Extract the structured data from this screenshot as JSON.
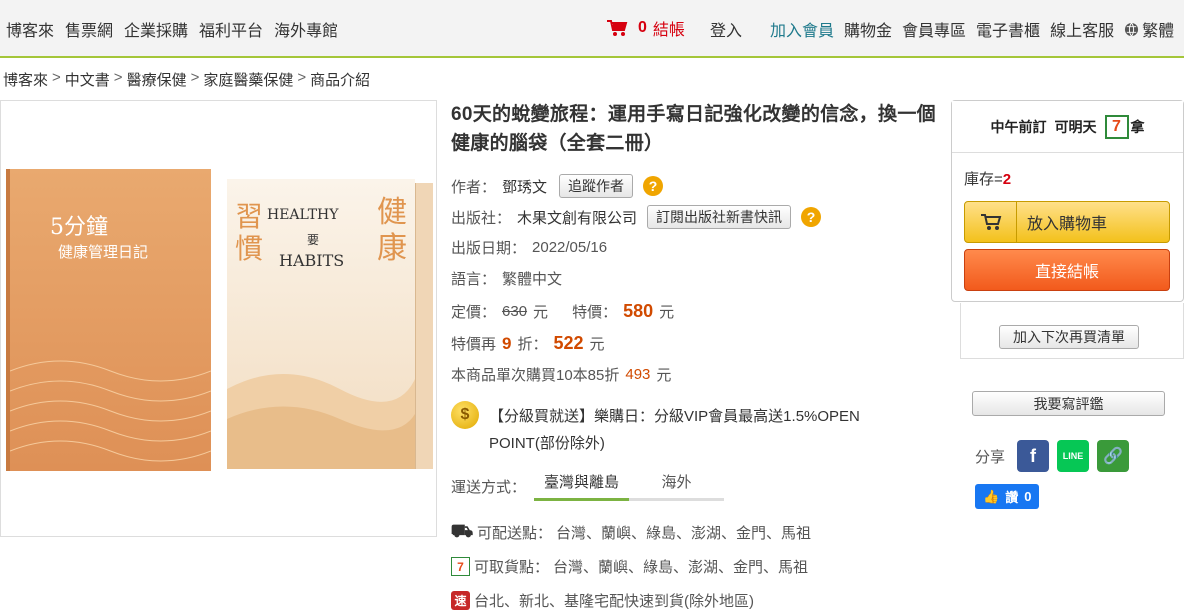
{
  "topbar": {
    "left_links": [
      "博客來",
      "售票網",
      "企業採購",
      "福利平台",
      "海外專館"
    ],
    "cart_count": "0",
    "cart_label": "結帳",
    "login": "登入",
    "right_links": [
      "加入會員",
      "購物金",
      "會員專區",
      "電子書櫃",
      "線上客服"
    ],
    "language": "繁體",
    "accent_color": "#a4c639"
  },
  "breadcrumb": [
    "博客來",
    "中文書",
    "醫療保健",
    "家庭醫藥保健",
    "商品介紹"
  ],
  "cover": {
    "book1_title": "5分鐘",
    "book1_subtitle": "健康管理日記",
    "book2_hz_left": "習慣",
    "book2_hz_right": "健康",
    "book2_en1": "HEALTHY",
    "book2_en2": "要",
    "book2_en3": "HABITS"
  },
  "product": {
    "title": "60天的蛻變旅程：運用手寫日記強化改變的信念，換一個健康的腦袋（全套二冊）",
    "author_label": "作者：",
    "author": "鄧琇文",
    "follow_author": "追蹤作者",
    "publisher_label": "出版社：",
    "publisher": "木果文創有限公司",
    "subscribe_publisher": "訂閱出版社新書快訊",
    "date_label": "出版日期：",
    "date": "2022/05/16",
    "lang_label": "語言：",
    "language": "繁體中文",
    "list_price_label": "定價：",
    "list_price": "630",
    "yuan": "元",
    "sale_label": "特價：",
    "sale_price": "580",
    "extra_label": "特價再",
    "extra_discount": "9",
    "extra_zhe": "折：",
    "extra_price": "522",
    "bulk_text": "本商品單次購買10本85折",
    "bulk_price": "493",
    "promo_text": "【分級買就送】樂購日：分級VIP會員最高送1.5%OPEN POINT(部份除外)",
    "ship_label": "運送方式：",
    "ship_tabs": [
      "臺灣與離島",
      "海外"
    ],
    "deliver_label": "可配送點：",
    "deliver_places": "台灣、蘭嶼、綠島、澎湖、金門、馬祖",
    "pickup_label": "可取貨點：",
    "pickup_places": "台灣、蘭嶼、綠島、澎湖、金門、馬祖",
    "fast_text": "台北、新北、基隆宅配快速到貨(除外地區)"
  },
  "sidebox": {
    "header_left": "中午前訂",
    "header_right": "可明天",
    "header_logo": "7",
    "header_end": "拿",
    "stock_label": "庫存=",
    "stock": "2",
    "add_cart": "放入購物車",
    "checkout": "直接結帳",
    "wishlist": "加入下次再買清單",
    "review": "我要寫評鑑",
    "share_label": "分享",
    "like_label": "讚",
    "like_count": "0"
  }
}
